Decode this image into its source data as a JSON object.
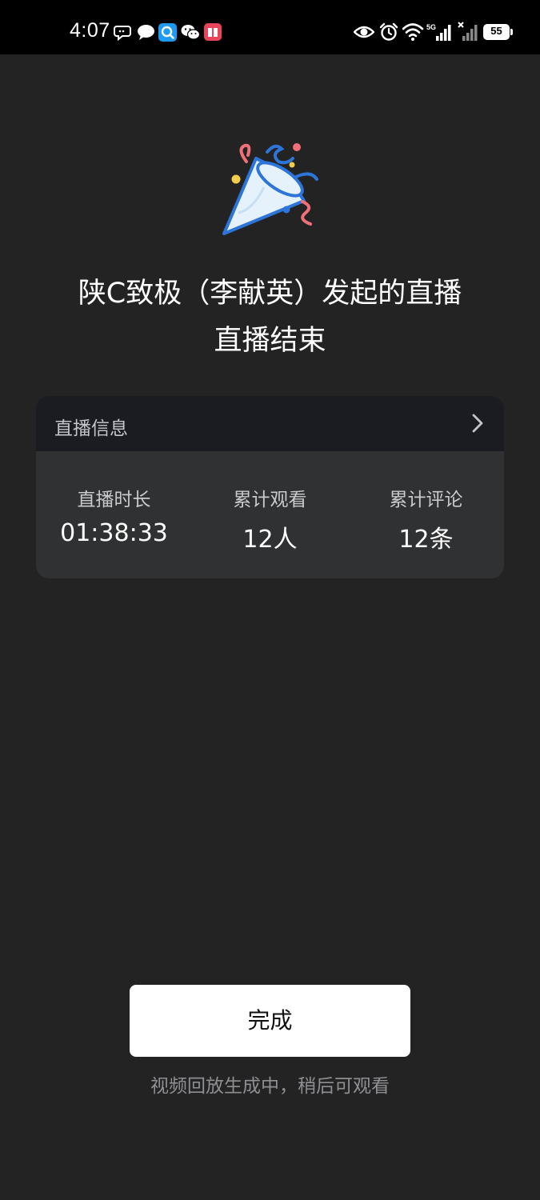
{
  "status_bar": {
    "time": "4:07",
    "battery": "55",
    "left_icons": [
      "chat-bubble-icon",
      "message-icon",
      "search-app-icon",
      "wechat-icon",
      "book-app-icon"
    ],
    "right_icons": [
      "eye-icon",
      "alarm-icon",
      "wifi-icon",
      "signal-5g-icon",
      "signal-icon"
    ]
  },
  "hero": {
    "icon": "party-popper-icon",
    "title_line1": "陕C致极（李献英）发起的直播",
    "title_line2": "直播结束"
  },
  "info_card": {
    "header": "直播信息",
    "stats": [
      {
        "label": "直播时长",
        "value": "01:38:33"
      },
      {
        "label": "累计观看",
        "value": "12人"
      },
      {
        "label": "累计评论",
        "value": "12条"
      }
    ]
  },
  "actions": {
    "done_label": "完成",
    "footnote": "视频回放生成中，稍后可观看"
  },
  "colors": {
    "background": "#232323",
    "card": "#303132",
    "card_header": "#1a1c22",
    "button": "#ffffff"
  }
}
